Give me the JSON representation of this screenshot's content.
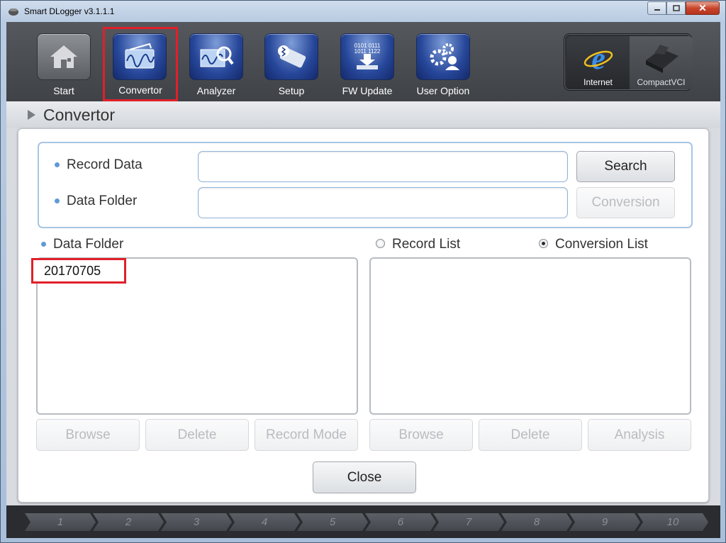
{
  "window": {
    "title": "Smart DLogger v3.1.1.1"
  },
  "toolbar": {
    "items": [
      {
        "label": "Start",
        "icon": "home-icon"
      },
      {
        "label": "Convertor",
        "icon": "convertor-icon"
      },
      {
        "label": "Analyzer",
        "icon": "analyzer-icon"
      },
      {
        "label": "Setup",
        "icon": "setup-icon"
      },
      {
        "label": "FW Update",
        "icon": "fw-update-icon"
      },
      {
        "label": "User Option",
        "icon": "user-option-icon"
      }
    ],
    "comm": [
      {
        "label": "Internet",
        "icon": "internet-explorer-icon"
      },
      {
        "label": "CompactVCI",
        "icon": "compactvci-icon"
      }
    ]
  },
  "section": {
    "title": "Convertor"
  },
  "record": {
    "record_data_label": "Record Data",
    "record_data_value": "",
    "data_folder_label": "Data Folder",
    "data_folder_value": "",
    "search_label": "Search",
    "conversion_label": "Conversion"
  },
  "left_list": {
    "label": "Data Folder",
    "entries": [
      "20170705"
    ],
    "buttons": [
      "Browse",
      "Delete",
      "Record Mode"
    ]
  },
  "right_list": {
    "radio_record": "Record List",
    "radio_conversion": "Conversion List",
    "selected": "Conversion List",
    "buttons": [
      "Browse",
      "Delete",
      "Analysis"
    ]
  },
  "close_label": "Close",
  "steps": [
    "1",
    "2",
    "3",
    "4",
    "5",
    "6",
    "7",
    "8",
    "9",
    "10"
  ],
  "colors": {
    "accent": "#5f9ad6",
    "highlight": "#e0202a",
    "toolbar": "#3f4247"
  }
}
